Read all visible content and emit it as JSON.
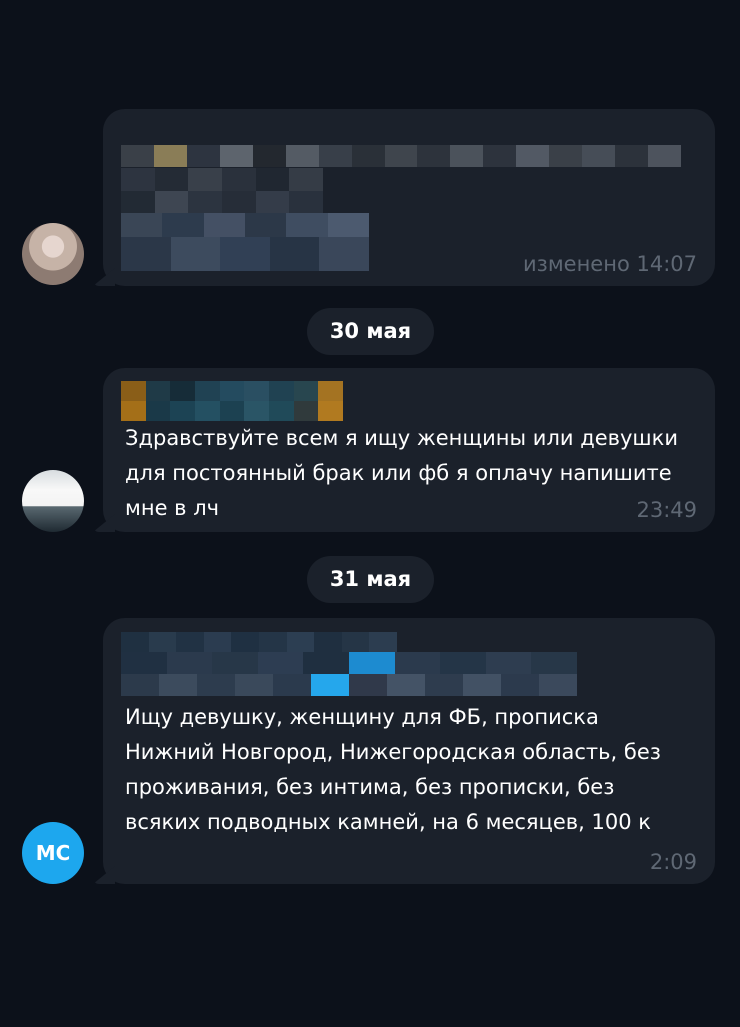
{
  "messages": [
    {
      "id": "msg1",
      "time": "изменено 14:07",
      "text": ""
    },
    {
      "id": "msg2",
      "text": "Здравствуйте всем я ищу женщины или девушки для постоянный брак или фб я оплачу напишите мне в лч",
      "time": "23:49"
    },
    {
      "id": "msg3",
      "text": "Ищу девушку, женщину для ФБ, прописка Нижний Новгород, Нижегородская область, без проживания, без интима, без прописки, без всяких подводных камней, на 6 месяцев, 100 к",
      "time": "2:09"
    }
  ],
  "dates": [
    "30 мая",
    "31 мая"
  ],
  "avatars": {
    "msg3": "МС"
  },
  "colors": {
    "background": "#0c111a",
    "bubble": "#1b212b",
    "muted_text": "#5f6874",
    "accent": "#1da7ee"
  },
  "icons": {
    "msg1_avatar": "profile-photo-icon",
    "msg2_avatar": "car-avatar-icon"
  }
}
